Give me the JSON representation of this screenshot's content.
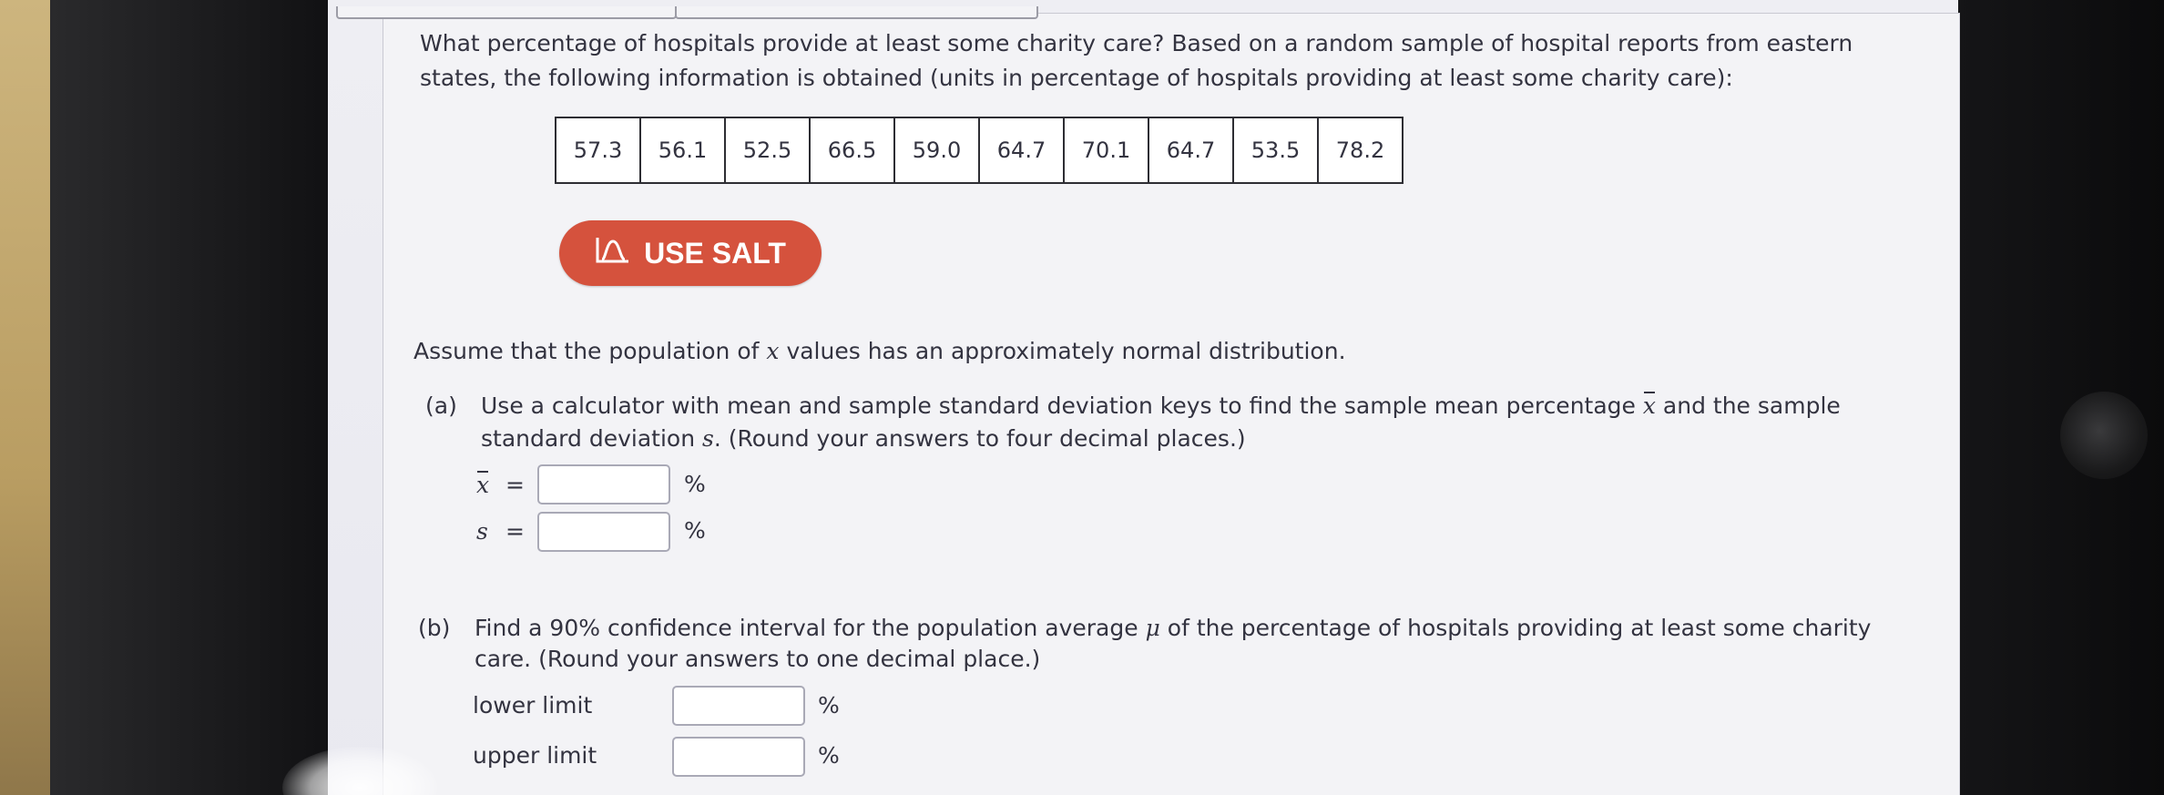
{
  "question": {
    "intro_line1": "What percentage of hospitals provide at least some charity care? Based on a random sample of hospital reports from eastern",
    "intro_line2": "states, the following information is obtained (units in percentage of hospitals providing at least some charity care):",
    "data_values": [
      "57.3",
      "56.1",
      "52.5",
      "66.5",
      "59.0",
      "64.7",
      "70.1",
      "64.7",
      "53.5",
      "78.2"
    ]
  },
  "salt_button": {
    "label": "USE SALT",
    "icon": "salt-icon",
    "color": "#d5523d"
  },
  "assumption": {
    "text_before": "Assume that the population of ",
    "variable": "x",
    "text_after": " values has an approximately normal distribution."
  },
  "part_a": {
    "label": "(a)",
    "line1_before": "Use a calculator with mean and sample standard deviation keys to find the sample mean percentage ",
    "line1_var": "x",
    "line1_after": " and the sample",
    "line2_before": "standard deviation ",
    "line2_var": "s",
    "line2_after": ". (Round your answers to four decimal places.)",
    "mean_symbol": "x",
    "sd_symbol": "s",
    "equals": "=",
    "unit": "%",
    "mean_value": "",
    "sd_value": ""
  },
  "part_b": {
    "label": "(b)",
    "line1_before": "Find a 90% confidence interval for the population average ",
    "line1_var": "μ",
    "line1_after": " of the percentage of hospitals providing at least some charity",
    "line2": "care. (Round your answers to one decimal place.)",
    "lower_label": "lower limit",
    "upper_label": "upper limit",
    "unit": "%",
    "lower_value": "",
    "upper_value": ""
  }
}
